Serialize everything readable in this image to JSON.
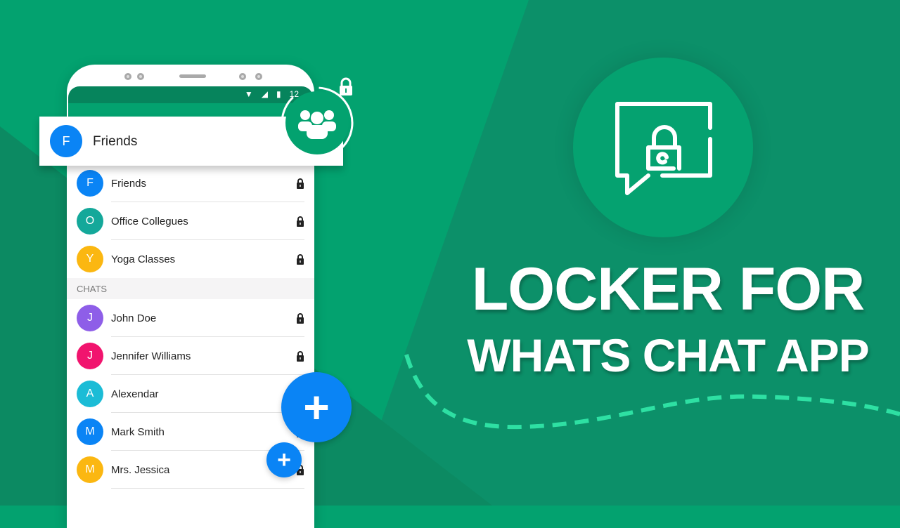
{
  "colors": {
    "bg_bright": "#03a26f",
    "bg_dark": "#0c9069",
    "bg_darker": "#0c8a62",
    "accent_blue": "#0a84f5",
    "dash": "#2ee0a3"
  },
  "phone": {
    "status_time": "12"
  },
  "popup": {
    "avatar_letter": "F",
    "avatar_color": "#0a84f5",
    "label": "Friends"
  },
  "groups": [
    {
      "letter": "F",
      "name": "Friends",
      "color": "#0a84f5",
      "locked": true
    },
    {
      "letter": "O",
      "name": "Office Collegues",
      "color": "#14a89a",
      "locked": true
    },
    {
      "letter": "Y",
      "name": "Yoga Classes",
      "color": "#fbb711",
      "locked": true
    }
  ],
  "chats_section_label": "CHATS",
  "chats": [
    {
      "letter": "J",
      "name": "John Doe",
      "color": "#8e5ee8",
      "locked": true
    },
    {
      "letter": "J",
      "name": "Jennifer Williams",
      "color": "#f1146e",
      "locked": true
    },
    {
      "letter": "A",
      "name": "Alexendar",
      "color": "#1bbcd6",
      "locked": false
    },
    {
      "letter": "M",
      "name": "Mark Smith",
      "color": "#0a84f5",
      "locked": true
    },
    {
      "letter": "M",
      "name": "Mrs. Jessica",
      "color": "#fbb711",
      "locked": true
    }
  ],
  "fab": {
    "symbol": "+"
  },
  "headline": {
    "line1": "LOCKER FOR",
    "line2": "WHATS CHAT APP"
  },
  "icons": {
    "group": "group-icon",
    "hero": "chat-lock-icon",
    "lock": "lock-icon",
    "add": "plus-icon"
  }
}
